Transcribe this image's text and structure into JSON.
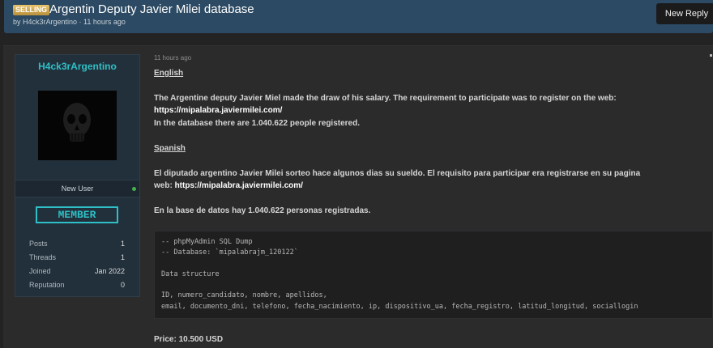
{
  "thread": {
    "prefix": "SELLING",
    "title": "Argentin Deputy Javier Milei database",
    "meta": "by H4ck3rArgentino · 11 hours ago",
    "reply_label": "New Reply"
  },
  "user": {
    "name": "H4ck3rArgentino",
    "role": "New User",
    "banner": "MEMBER",
    "stats": [
      {
        "label": "Posts",
        "value": "1"
      },
      {
        "label": "Threads",
        "value": "1"
      },
      {
        "label": "Joined",
        "value": "Jan 2022"
      },
      {
        "label": "Reputation",
        "value": "0"
      }
    ]
  },
  "post": {
    "time": "11 hours ago",
    "english_heading": "English",
    "english_line1": "The Argentine deputy Javier Miel made the draw of his salary. The requirement to participate was to register on the web:",
    "english_link": "https://mipalabra.javiermilei.com/",
    "english_line3": "In the database there are 1.040.622 people registered.",
    "spanish_heading": "Spanish",
    "spanish_line1": "El diputado argentino Javier Milei sorteo hace algunos dias su sueldo. El requisito para participar era registrarse en su pagina",
    "spanish_line2_prefix": "web: ",
    "spanish_link": "https://mipalabra.javiermilei.com/",
    "spanish_line3": "En la base de datos hay 1.040.622 personas registradas.",
    "code": [
      "-- phpMyAdmin SQL Dump",
      "-- Database: `mipalabrajm_120122`",
      "Data structure",
      "ID, numero_candidato, nombre, apellidos,",
      "email, documento_dni, telefono, fecha_nacimiento, ip, dispositivo_ua, fecha_registro, latitud_longitud, sociallogin"
    ],
    "price": "Price: 10.500 USD"
  }
}
